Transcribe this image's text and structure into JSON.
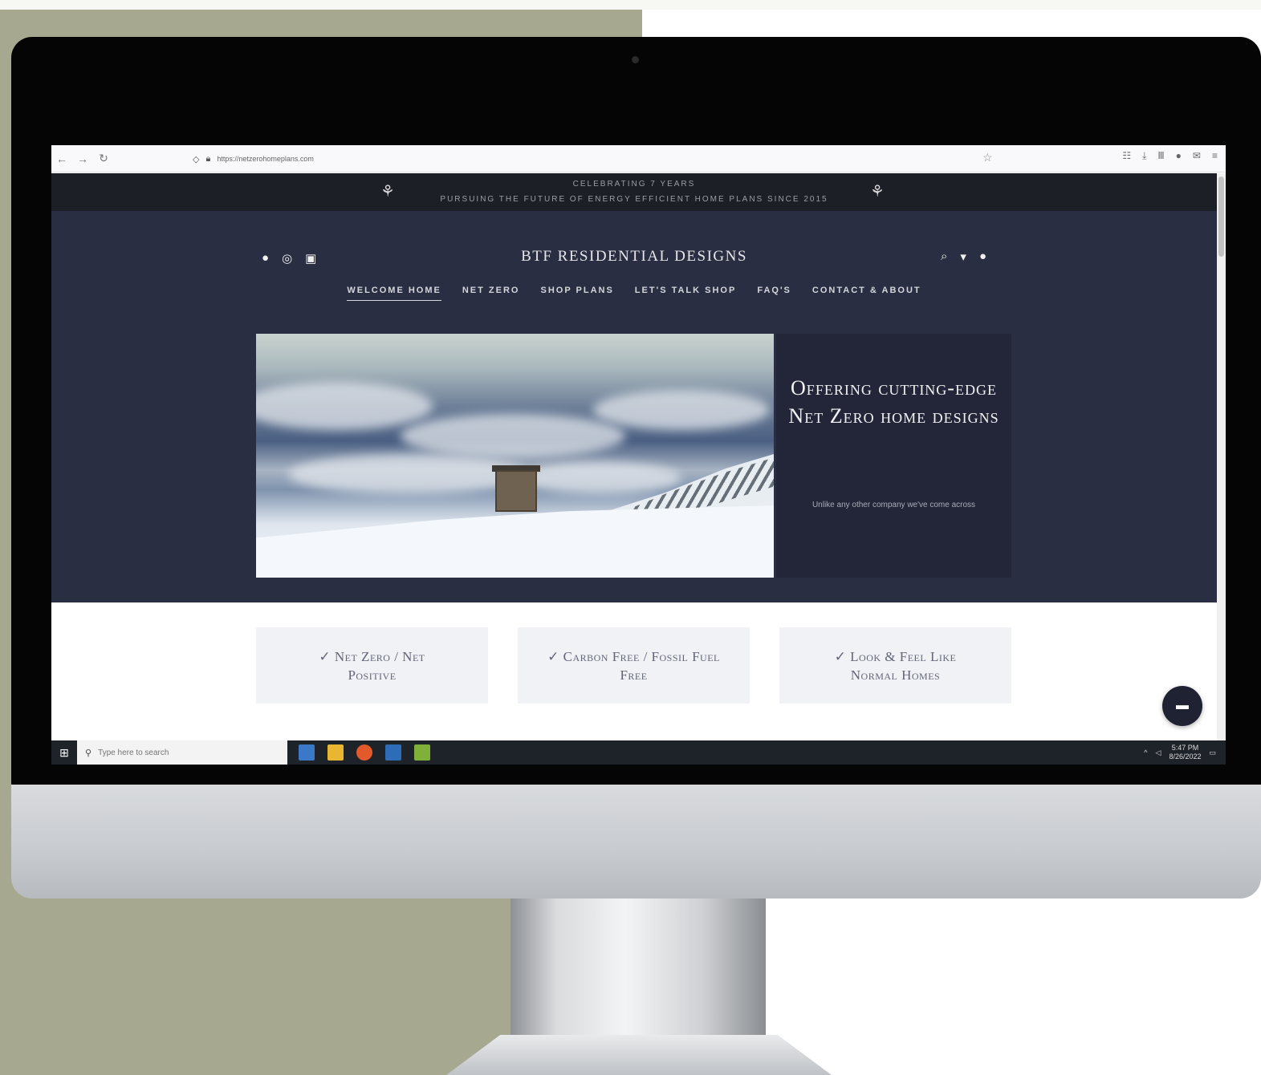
{
  "browser": {
    "nav_icons": [
      "←",
      "→",
      "↻"
    ],
    "url": "https://netzerohomeplans.com",
    "right_icons": [
      "☷",
      "⤓",
      "Ⅲ",
      "●",
      "✉",
      "≡"
    ]
  },
  "announcement": {
    "line1": "CELEBRATING 7 YEARS",
    "line2": "PURSUING THE FUTURE OF ENERGY EFFICIENT HOME PLANS SINCE 2015"
  },
  "header": {
    "brand": "BTF RESIDENTIAL DESIGNS",
    "nav": [
      {
        "label": "WELCOME HOME"
      },
      {
        "label": "NET ZERO"
      },
      {
        "label": "SHOP PLANS"
      },
      {
        "label": "LET'S TALK SHOP"
      },
      {
        "label": "FAQ'S"
      },
      {
        "label": "CONTACT & ABOUT"
      }
    ]
  },
  "hero": {
    "title": "Offering cutting-edge Net Zero home designs",
    "subtitle": "Unlike any other company we've come across"
  },
  "features": [
    {
      "label": "✓ Net Zero / Net Positive"
    },
    {
      "label": "✓ Carbon Free / Fossil Fuel Free"
    },
    {
      "label": "✓ Look & Feel Like Normal Homes"
    }
  ],
  "taskbar": {
    "search_placeholder": "Type here to search",
    "time": "5:47 PM",
    "date": "8/26/2022"
  },
  "colors": {
    "navy": "#2a2e42",
    "dark_panel": "#222638",
    "backdrop_sage": "#a7a890"
  }
}
